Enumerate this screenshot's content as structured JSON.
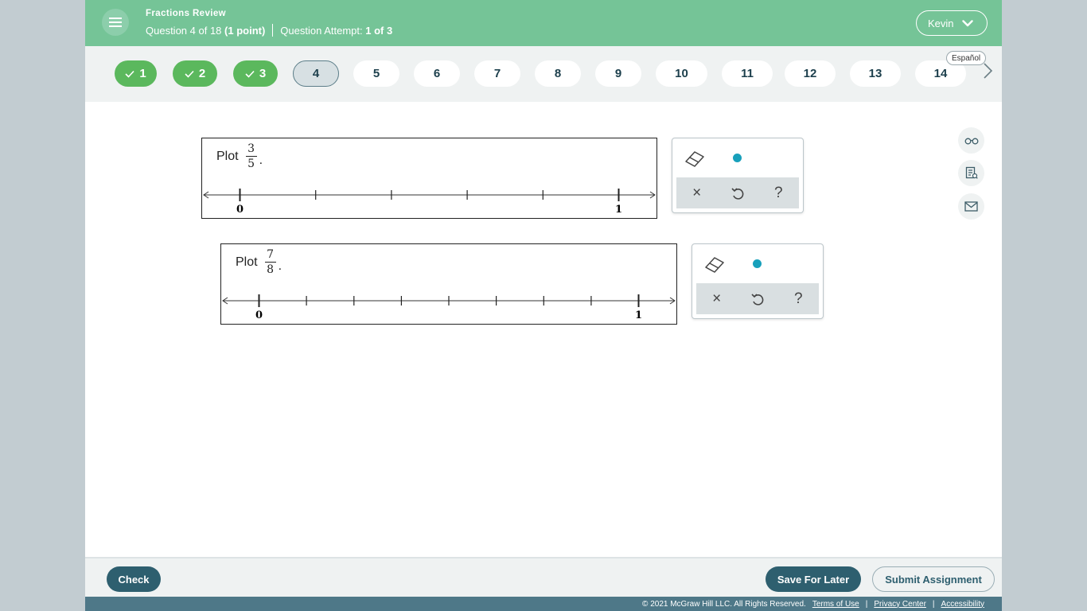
{
  "header": {
    "assignment_title": "Fractions Review",
    "question_counter": "Question 4 of 18",
    "points": "(1 point)",
    "attempt_label": "Question Attempt:",
    "attempt_value": "1 of 3",
    "user_name": "Kevin"
  },
  "question_nav": {
    "items": [
      {
        "label": "1",
        "status": "done"
      },
      {
        "label": "2",
        "status": "done"
      },
      {
        "label": "3",
        "status": "done"
      },
      {
        "label": "4",
        "status": "current"
      },
      {
        "label": "5",
        "status": "open"
      },
      {
        "label": "6",
        "status": "open"
      },
      {
        "label": "7",
        "status": "open"
      },
      {
        "label": "8",
        "status": "open"
      },
      {
        "label": "9",
        "status": "open"
      },
      {
        "label": "10",
        "status": "open"
      },
      {
        "label": "11",
        "status": "open"
      },
      {
        "label": "12",
        "status": "open"
      },
      {
        "label": "13",
        "status": "open"
      },
      {
        "label": "14",
        "status": "open"
      }
    ],
    "language_label": "Español"
  },
  "problems": [
    {
      "prompt": "Plot",
      "numerator": "3",
      "denominator": "5",
      "period": ".",
      "start_label": "0",
      "end_label": "1",
      "divisions": 5
    },
    {
      "prompt": "Plot",
      "numerator": "7",
      "denominator": "8",
      "period": ".",
      "start_label": "0",
      "end_label": "1",
      "divisions": 8
    }
  ],
  "tools": {
    "icons": [
      "eraser-icon",
      "point-tool",
      "close-icon",
      "undo-icon",
      "help-icon"
    ],
    "clear_symbol": "×",
    "help_symbol": "?"
  },
  "side_tools": [
    "reader-glasses-icon",
    "notes-icon",
    "mail-icon"
  ],
  "footer": {
    "check_label": "Check",
    "save_label": "Save For Later",
    "submit_label": "Submit Assignment",
    "copyright": "© 2021 McGraw Hill LLC. All Rights Reserved.",
    "terms": "Terms of Use",
    "privacy": "Privacy Center",
    "accessibility": "Accessibility"
  },
  "colors": {
    "header": "#75c497",
    "done_pill": "#5bb85d",
    "primary_button": "#2e5f6f",
    "point_tool": "#18a0bb",
    "legal_bar": "#4e7888"
  }
}
